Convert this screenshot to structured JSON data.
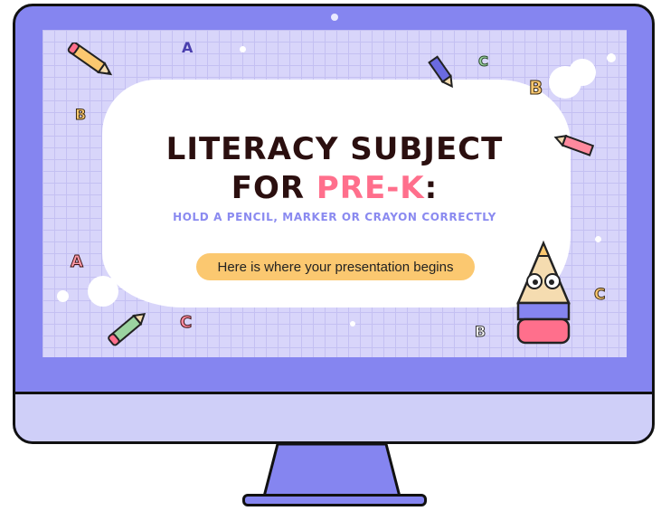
{
  "slide": {
    "title_line1": "LITERACY SUBJECT",
    "title_line2_prefix": "FOR",
    "title_line2_highlight": "PRE-K",
    "title_line2_suffix": ":",
    "subtitle": "HOLD A PENCIL, MARKER OR CRAYON CORRECTLY",
    "cta_label": "Here is where your presentation begins"
  },
  "decor_letters": [
    "A",
    "B",
    "C",
    "B",
    "A",
    "C",
    "C",
    "B"
  ],
  "colors": {
    "monitor": "#8585f0",
    "chin": "#cfcff8",
    "screen": "#d8d5fa",
    "title": "#2b0f0f",
    "highlight": "#ff6f8c",
    "subtitle": "#8a8af0",
    "cta": "#fbc870"
  }
}
